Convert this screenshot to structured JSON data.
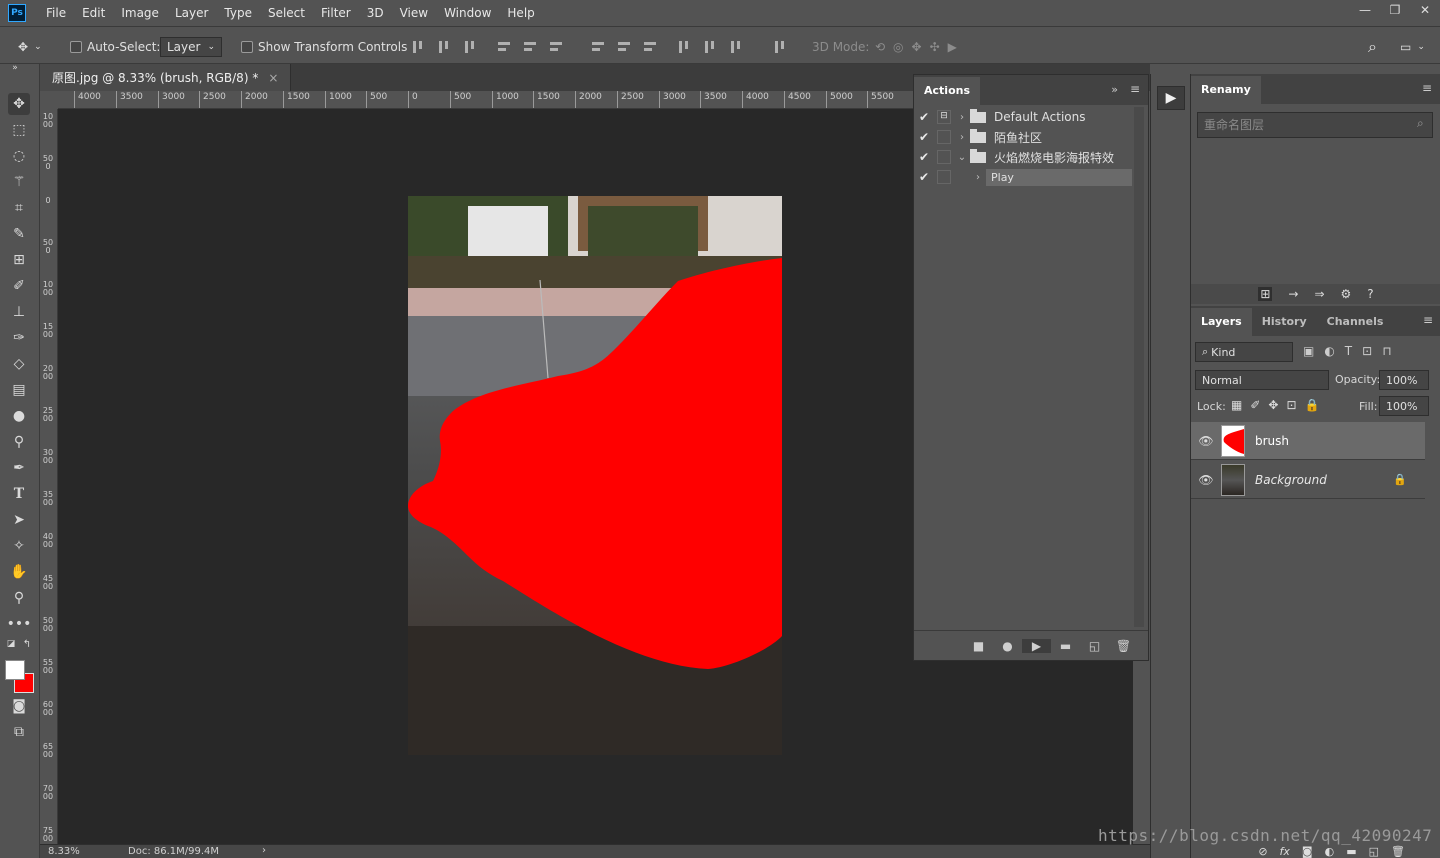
{
  "app": {
    "logo": "Ps"
  },
  "menu": [
    "File",
    "Edit",
    "Image",
    "Layer",
    "Type",
    "Select",
    "Filter",
    "3D",
    "View",
    "Window",
    "Help"
  ],
  "window_controls": {
    "minimize": "—",
    "restore": "❐",
    "close": "✕"
  },
  "options": {
    "auto_select_label": "Auto-Select:",
    "auto_select_value": "Layer",
    "show_transform_label": "Show Transform Controls",
    "mode_3d_label": "3D Mode:"
  },
  "document": {
    "tab_title": "原图.jpg @ 8.33% (brush, RGB/8) *",
    "close": "×",
    "zoom": "8.33%",
    "doc_size": "Doc: 86.1M/99.4M"
  },
  "ruler": {
    "h_labels": [
      "4000",
      "3500",
      "3000",
      "2500",
      "2000",
      "1500",
      "1000",
      "500",
      "0",
      "500",
      "1000",
      "1500",
      "2000",
      "2500",
      "3000",
      "3500",
      "4000",
      "4500",
      "5000",
      "5500"
    ],
    "v_labels": [
      "1000",
      "500",
      "0",
      "500",
      "1000",
      "1500",
      "2000",
      "2500",
      "3000",
      "3500",
      "4000",
      "4500",
      "5000",
      "5500",
      "6000",
      "6500",
      "7000",
      "7500"
    ]
  },
  "actions_panel": {
    "tab": "Actions",
    "items": [
      {
        "label": "Default Actions",
        "checked": true
      },
      {
        "label": "陌鱼社区",
        "checked": true
      },
      {
        "label": "火焰燃烧电影海报特效",
        "checked": true
      },
      {
        "label": "Play",
        "checked": true
      }
    ]
  },
  "renamy_panel": {
    "tab": "Renamy",
    "placeholder": "重命名图层"
  },
  "layers_panel": {
    "tabs": [
      "Layers",
      "History",
      "Channels"
    ],
    "kind_label": "Kind",
    "blend_mode": "Normal",
    "opacity_label": "Opacity:",
    "opacity_value": "100%",
    "lock_label": "Lock:",
    "fill_label": "Fill:",
    "fill_value": "100%",
    "layers": [
      {
        "name": "brush",
        "selected": true
      },
      {
        "name": "Background",
        "locked": true
      }
    ]
  },
  "watermark": "https://blog.csdn.net/qq_42090247",
  "colors": {
    "foreground": "#ffffff",
    "background": "#ff0000",
    "brush_fill": "#ff0000"
  }
}
